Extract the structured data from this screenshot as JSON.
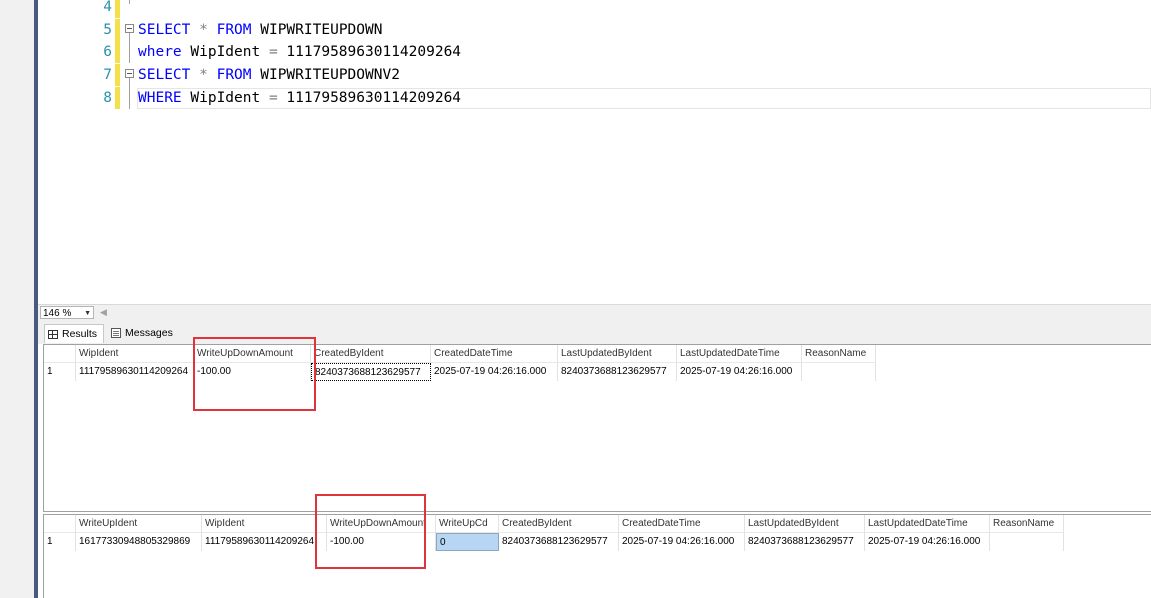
{
  "editor": {
    "lines": [
      {
        "num": "4",
        "text": ""
      },
      {
        "num": "5",
        "kw1": "SELECT",
        "op": " * ",
        "kw2": "FROM",
        "rest": " WIPWRITEUPDOWN"
      },
      {
        "num": "6",
        "kw1": "where",
        "rest": " WipIdent ",
        "op": "=",
        "rest2": " 1117958963011420926­4"
      },
      {
        "num": "7",
        "kw1": "SELECT",
        "op": " * ",
        "kw2": "FROM",
        "rest": " WIPWRITEUPDOWNV2"
      },
      {
        "num": "8",
        "kw1": "WHERE",
        "rest": " WipIdent ",
        "op": "=",
        "rest2": " 11179589630114209264"
      }
    ]
  },
  "zoom": {
    "value": "146 %"
  },
  "tabs": {
    "results": "Results",
    "messages": "Messages"
  },
  "grid1": {
    "headers": [
      "WipIdent",
      "WriteUpDownAmount",
      "CreatedByIdent",
      "CreatedDateTime",
      "LastUpdatedByIdent",
      "LastUpdatedDateTime",
      "ReasonName"
    ],
    "rows": [
      {
        "num": "1",
        "cells": [
          "11179589630114209264",
          "-100.00",
          "8240373688123629577",
          "2025-07-19 04:26:16.000",
          "8240373688123629577",
          "2025-07-19 04:26:16.000",
          ""
        ]
      }
    ]
  },
  "grid2": {
    "headers": [
      "WriteUpIdent",
      "WipIdent",
      "WriteUpDownAmount",
      "WriteUpCd",
      "CreatedByIdent",
      "CreatedDateTime",
      "LastUpdatedByIdent",
      "LastUpdatedDateTime",
      "ReasonName"
    ],
    "rows": [
      {
        "num": "1",
        "cells": [
          "16177330948805329869",
          "11179589630114209264",
          "-100.00",
          "0",
          "8240373688123629577",
          "2025-07-19 04:26:16.000",
          "8240373688123629577",
          "2025-07-19 04:26:16.000",
          ""
        ]
      }
    ]
  },
  "colors": {
    "highlight_box": "#e0343c",
    "keyword": "#0000ff",
    "line_number": "#2b91af",
    "change_marker": "#f5e04a"
  }
}
